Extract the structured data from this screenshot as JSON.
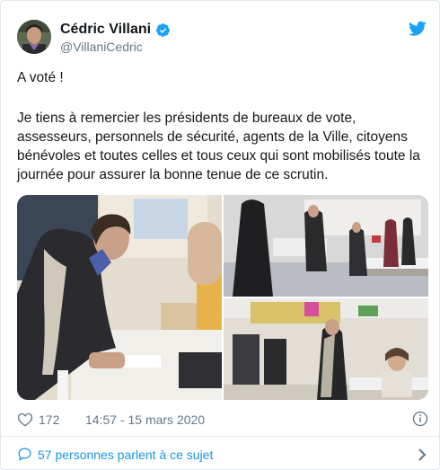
{
  "author": {
    "display_name": "Cédric Villani",
    "handle": "@VillaniCedric",
    "verified": true
  },
  "tweet": {
    "line1": "A voté !",
    "para2": "Je tiens à remercier les présidents de bureaux de vote, assesseurs, personnels de sécurité, agents de la Ville, citoyens bénévoles et toutes celles et tous ceux qui sont mobilisés toute la journée pour assurer la bonne tenue de ce scrutin."
  },
  "meta": {
    "likes": "172",
    "timestamp": "14:57 - 15 mars 2020"
  },
  "footer": {
    "people_talking": "57 personnes parlent à ce sujet"
  },
  "icons": {
    "verified": "verified-badge-icon",
    "brand": "twitter-bird-icon",
    "like": "heart-icon",
    "info": "info-icon",
    "reply": "speech-bubble-icon",
    "more": "chevron-right-icon"
  },
  "colors": {
    "link": "#1b95e0",
    "muted": "#657786",
    "text": "#14171a",
    "border": "#e1e8ed"
  }
}
